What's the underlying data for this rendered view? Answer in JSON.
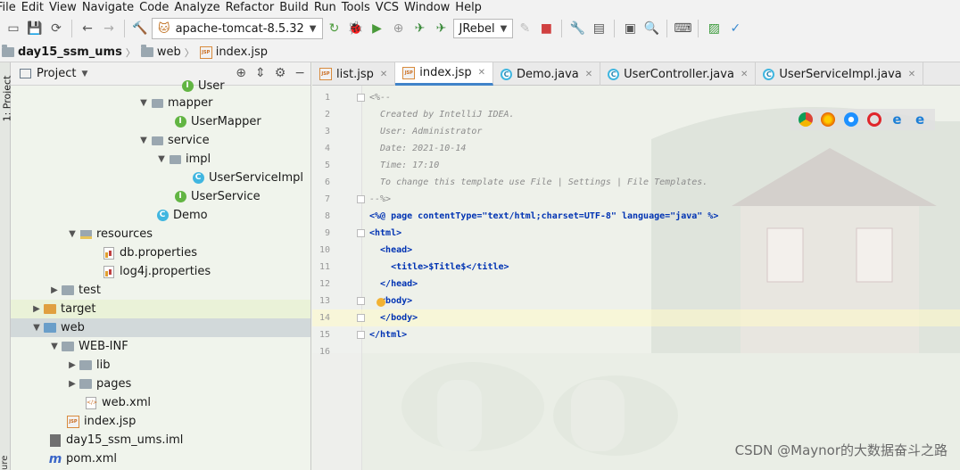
{
  "menu": [
    "File",
    "Edit",
    "View",
    "Navigate",
    "Code",
    "Analyze",
    "Refactor",
    "Build",
    "Run",
    "Tools",
    "VCS",
    "Window",
    "Help"
  ],
  "toolbar": {
    "run_config": "apache-tomcat-8.5.32",
    "jrebel": "JRebel"
  },
  "breadcrumb": [
    "day15_ssm_ums",
    "web",
    "index.jsp"
  ],
  "side_stripe": {
    "project": "1: Project",
    "structure": "ure"
  },
  "project_panel": {
    "title": "Project",
    "items": [
      {
        "label": "User",
        "type": "interface"
      },
      {
        "label": "mapper",
        "type": "package"
      },
      {
        "label": "UserMapper",
        "type": "interface"
      },
      {
        "label": "service",
        "type": "package"
      },
      {
        "label": "impl",
        "type": "package"
      },
      {
        "label": "UserServiceImpl",
        "type": "class"
      },
      {
        "label": "UserService",
        "type": "interface"
      },
      {
        "label": "Demo",
        "type": "class"
      },
      {
        "label": "resources",
        "type": "resources"
      },
      {
        "label": "db.properties",
        "type": "properties"
      },
      {
        "label": "log4j.properties",
        "type": "properties"
      },
      {
        "label": "test",
        "type": "folder"
      },
      {
        "label": "target",
        "type": "folder"
      },
      {
        "label": "web",
        "type": "folder"
      },
      {
        "label": "WEB-INF",
        "type": "folder"
      },
      {
        "label": "lib",
        "type": "folder"
      },
      {
        "label": "pages",
        "type": "folder"
      },
      {
        "label": "web.xml",
        "type": "xml"
      },
      {
        "label": "index.jsp",
        "type": "jsp"
      },
      {
        "label": "day15_ssm_ums.iml",
        "type": "iml"
      },
      {
        "label": "pom.xml",
        "type": "maven"
      }
    ]
  },
  "tabs": [
    {
      "label": "list.jsp",
      "type": "jsp",
      "active": false
    },
    {
      "label": "index.jsp",
      "type": "jsp",
      "active": true
    },
    {
      "label": "Demo.java",
      "type": "java",
      "active": false
    },
    {
      "label": "UserController.java",
      "type": "java",
      "active": false
    },
    {
      "label": "UserServiceImpl.java",
      "type": "java",
      "active": false
    }
  ],
  "editor": {
    "lines": [
      {
        "n": "1",
        "text": "<%--"
      },
      {
        "n": "2",
        "text": "  Created by IntelliJ IDEA."
      },
      {
        "n": "3",
        "text": "  User: Administrator"
      },
      {
        "n": "4",
        "text": "  Date: 2021-10-14"
      },
      {
        "n": "5",
        "text": "  Time: 17:10"
      },
      {
        "n": "6",
        "text": "  To change this template use File | Settings | File Templates."
      },
      {
        "n": "7",
        "text": "--%>"
      },
      {
        "n": "8",
        "text": "<%@ page contentType=\"text/html;charset=UTF-8\" language=\"java\" %>"
      },
      {
        "n": "9",
        "text": "<html>"
      },
      {
        "n": "10",
        "text": "  <head>"
      },
      {
        "n": "11",
        "text": "    <title>$Title$</title>"
      },
      {
        "n": "12",
        "text": "  </head>"
      },
      {
        "n": "13",
        "text": "  <body>"
      },
      {
        "n": "14",
        "text": "  </body>"
      },
      {
        "n": "15",
        "text": "</html>"
      },
      {
        "n": "16",
        "text": ""
      }
    ]
  },
  "watermark": "CSDN @Maynor的大数据奋斗之路"
}
